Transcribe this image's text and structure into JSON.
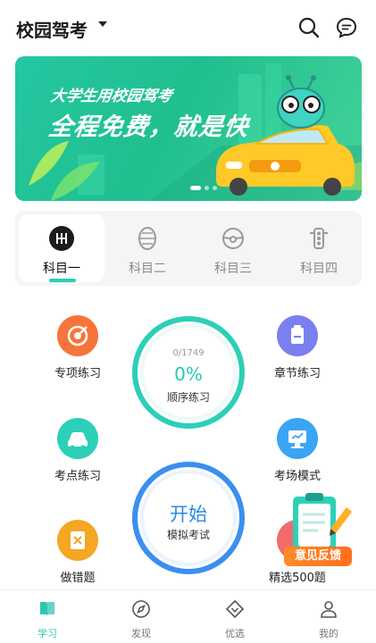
{
  "header": {
    "title": "校园驾考",
    "search_icon": "search-icon",
    "message_icon": "message-icon"
  },
  "banner": {
    "slogan_line1": "大学生用校园驾考",
    "slogan_line2": "全程免费，就是快",
    "slide_count": 3,
    "active_slide": 1
  },
  "subjects": {
    "tabs": [
      {
        "label": "科目一",
        "icon": "gearshift-icon",
        "active": true
      },
      {
        "label": "科目二",
        "icon": "tire-icon",
        "active": false
      },
      {
        "label": "科目三",
        "icon": "steering-wheel-icon",
        "active": false
      },
      {
        "label": "科目四",
        "icon": "traffic-light-icon",
        "active": false
      }
    ]
  },
  "practice": {
    "special_label": "专项练习",
    "chapter_label": "章节练习",
    "sequential": {
      "count": "0/1749",
      "percent": "0%",
      "label": "顺序练习",
      "progress": 0
    },
    "keypoint_label": "考点练习",
    "exam_mode_label": "考场模式",
    "mock_exam": {
      "start": "开始",
      "label": "模拟考试"
    },
    "wrong_label": "做错题",
    "selected_label": "精选500题"
  },
  "feedback": {
    "label": "意见反馈"
  },
  "bottom_nav": {
    "items": [
      {
        "label": "学习",
        "icon": "book-icon",
        "active": true
      },
      {
        "label": "发现",
        "icon": "compass-icon",
        "active": false
      },
      {
        "label": "优选",
        "icon": "diamond-icon",
        "active": false
      },
      {
        "label": "我的",
        "icon": "user-icon",
        "active": false
      }
    ]
  },
  "colors": {
    "accent": "#2cc7b3",
    "exam_blue": "#2b8ae8",
    "special_orange": "#f7743a",
    "chapter_purple": "#7b7ff0",
    "keypoint_teal": "#2ccfb7",
    "exam_mode_blue": "#3aa5f3",
    "wrong_yellow": "#f5a623",
    "feedback_orange": "#ff7a22"
  }
}
